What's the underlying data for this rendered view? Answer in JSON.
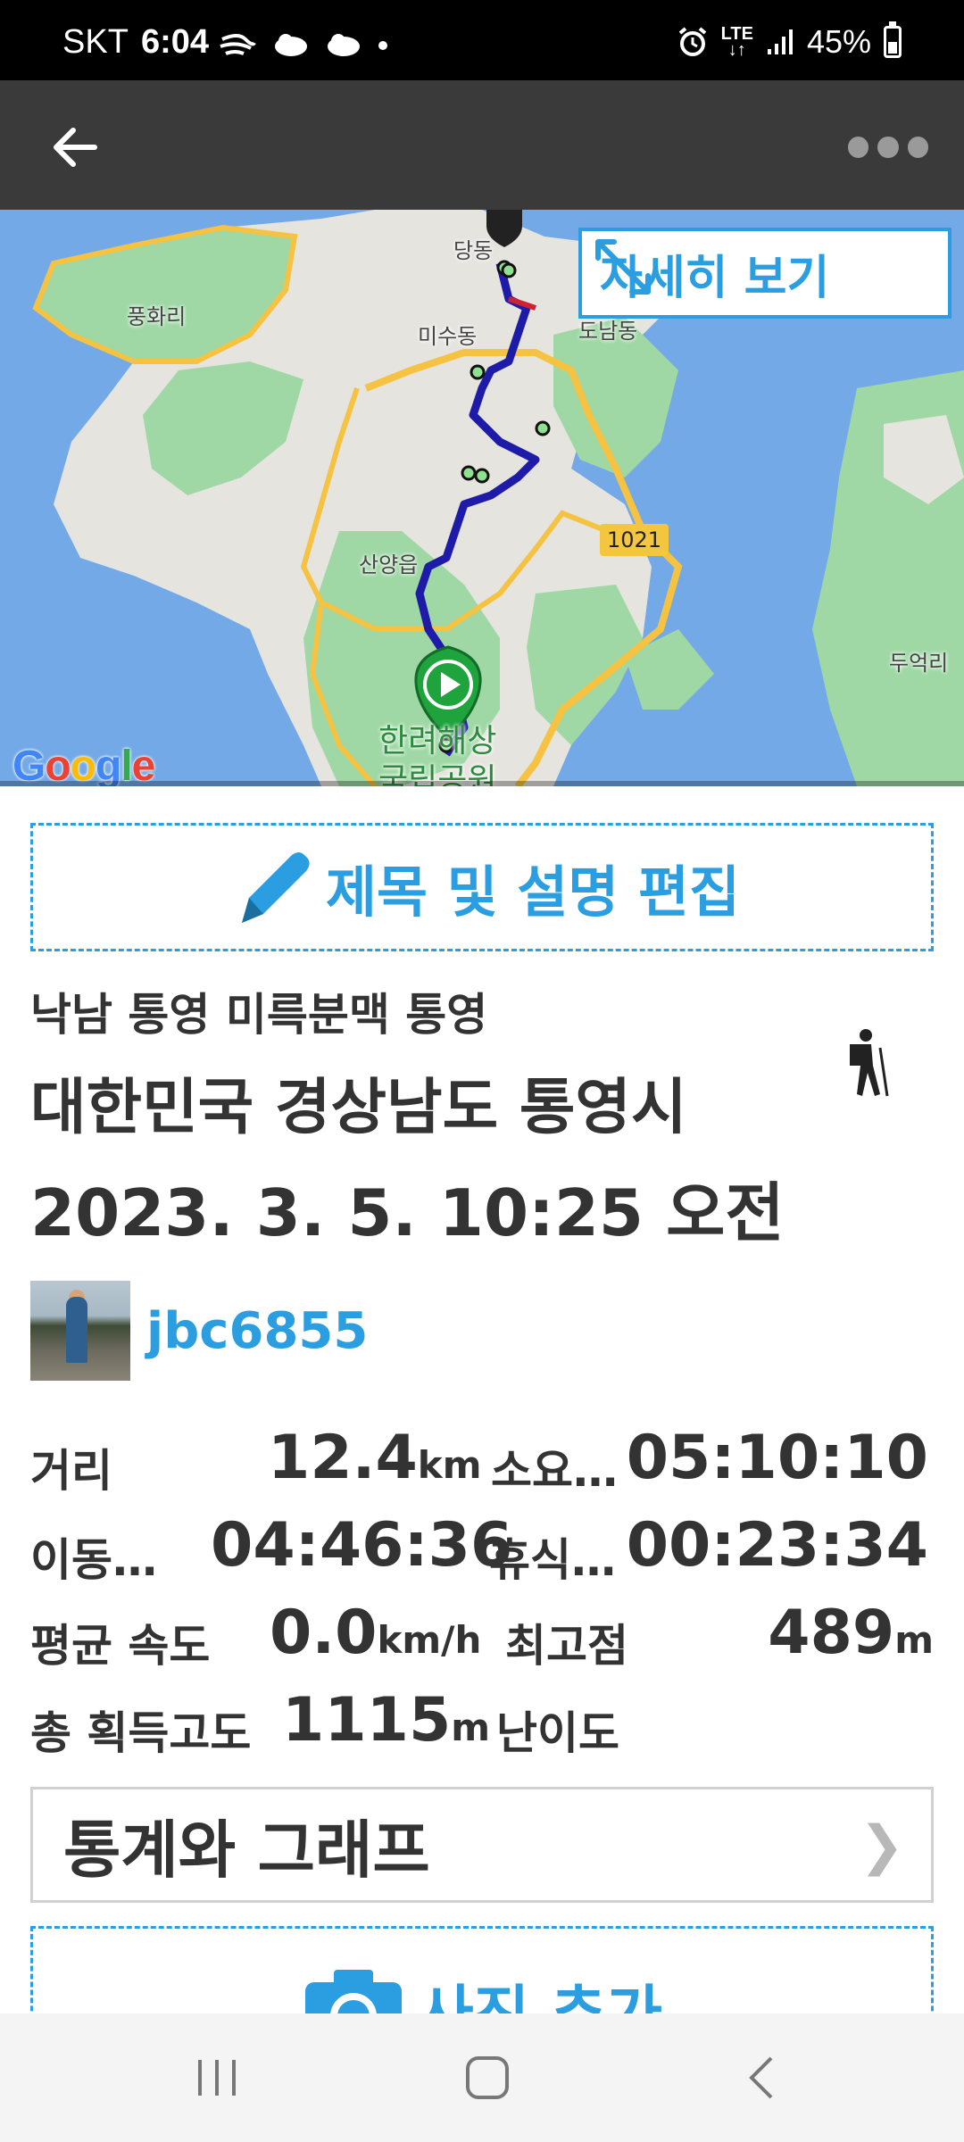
{
  "status_bar": {
    "carrier": "SKT",
    "time": "6:04",
    "notification_icons": [
      "wind-icon",
      "cloud-icon",
      "cloud-icon",
      "dot-icon"
    ],
    "alarm_icon": "alarm-icon",
    "network_top": "LTE",
    "network_bottom": "↓↑",
    "battery": "45%",
    "battery_level": 0.45
  },
  "app_bar": {
    "back_icon": "arrow-left-icon",
    "menu_icon": "more-dots-icon"
  },
  "map": {
    "details_label": "자세히 보기",
    "road_number": "1021",
    "attribution": "Google",
    "places": {
      "dangdong": "당동",
      "punghwari": "풍화리",
      "misudong": "미수동",
      "donamdong": "도남동",
      "sanyangeup": "산양읍",
      "dueokri": "두억리",
      "park_line1": "한려해상",
      "park_line2": "국립공원"
    },
    "colors": {
      "water": "#73a9e7",
      "land": "#e6e4df",
      "green": "#9fd8a5",
      "road": "#f5c242",
      "route": "#1d1ba8"
    }
  },
  "edit": {
    "label": "제목 및 설명 편집",
    "icon": "pencil-icon"
  },
  "track": {
    "title": "낙남 통영 미륵분맥 통영",
    "location": "대한민국 경상남도 통영시",
    "datetime": "2023. 3. 5. 10:25 오전",
    "activity_icon": "hiker-icon"
  },
  "user": {
    "name": "jbc6855"
  },
  "stats": {
    "distance_label": "거리",
    "distance_value": "12.4",
    "distance_unit": "km",
    "elapsed_label": "소요…",
    "elapsed_value": "05:10:10",
    "moving_label": "이동…",
    "moving_value": "04:46:36",
    "rest_label": "휴식…",
    "rest_value": "00:23:34",
    "avg_speed_label": "평균 속도",
    "avg_speed_value": "0.0",
    "avg_speed_unit": "km/h",
    "max_alt_label": "최고점",
    "max_alt_value": "489",
    "max_alt_unit": "m",
    "gain_label": "총 획득고도",
    "gain_value": "1115",
    "gain_unit": "m",
    "difficulty_label": "난이도"
  },
  "stats_button": {
    "label": "통계와 그래프",
    "chevron": "❯"
  },
  "photo_button": {
    "label": "사진 추가",
    "icon": "camera-icon"
  },
  "nav_bar": {
    "recents_icon": "recent-apps-icon",
    "home_icon": "home-icon",
    "back_icon": "back-chevron-icon"
  }
}
